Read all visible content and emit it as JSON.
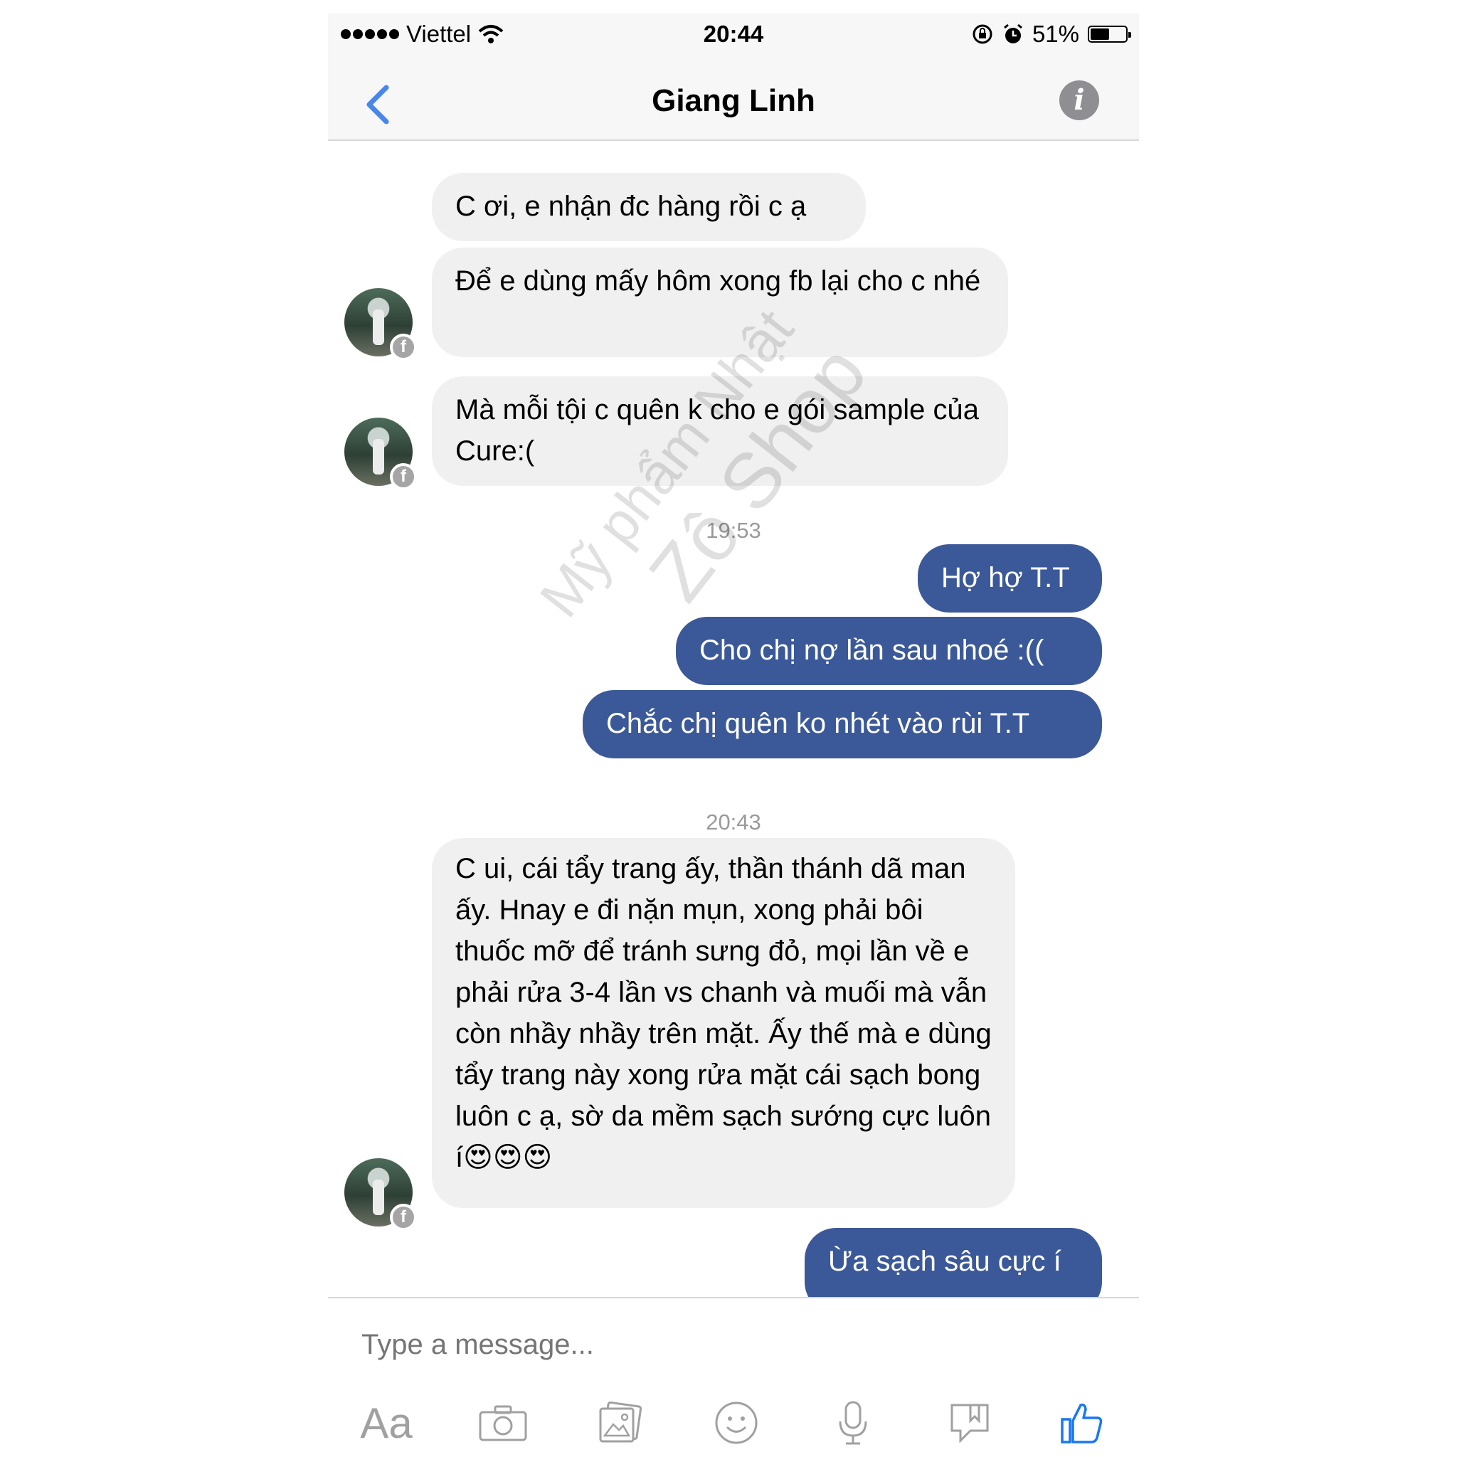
{
  "status": {
    "carrier": "Viettel",
    "time": "20:44",
    "battery": "51%"
  },
  "header": {
    "title": "Giang Linh"
  },
  "messages": [
    {
      "dir": "in",
      "text": "C ơi, e nhận đc hàng rồi c ạ"
    },
    {
      "dir": "in",
      "text": "Để e dùng mấy hôm xong fb lại cho c nhé"
    },
    {
      "dir": "in",
      "text": "Mà mỗi tội c quên k cho e gói sample của Cure:("
    },
    {
      "timestamp": "19:53"
    },
    {
      "dir": "out",
      "text": "Hợ hợ T.T"
    },
    {
      "dir": "out",
      "text": "Cho chị nợ lần sau nhoé :(("
    },
    {
      "dir": "out",
      "text": "Chắc chị quên ko nhét vào rùi T.T"
    },
    {
      "timestamp": "20:43"
    },
    {
      "dir": "in",
      "text": "C ui, cái tẩy trang ấy, thần thánh dã man ấy. Hnay e đi nặn mụn, xong phải bôi thuốc mỡ để tránh sưng đỏ, mọi lần về e phải rửa 3-4 lần vs chanh và muối mà vẫn còn nhầy nhầy trên mặt. Ấy thế mà e dùng tẩy trang này xong rửa mặt cái sạch bong luôn c ạ, sờ da mềm sạch sướng cực luôn í😍😍😍"
    },
    {
      "dir": "out",
      "text": "Ừa sạch sâu cực í"
    }
  ],
  "watermark": {
    "line1": "Mỹ phẩm Nhật",
    "line2": "Zô Shop"
  },
  "composer": {
    "placeholder": "Type a message...",
    "tools": [
      "text-icon",
      "camera-icon",
      "gallery-icon",
      "emoji-icon",
      "microphone-icon",
      "sticker-icon",
      "like-icon"
    ],
    "aa_label": "Aa"
  },
  "colors": {
    "accent": "#4a86e8",
    "outgoing": "#3b5998",
    "incoming": "#f0f0f0",
    "like": "#1877f2"
  }
}
